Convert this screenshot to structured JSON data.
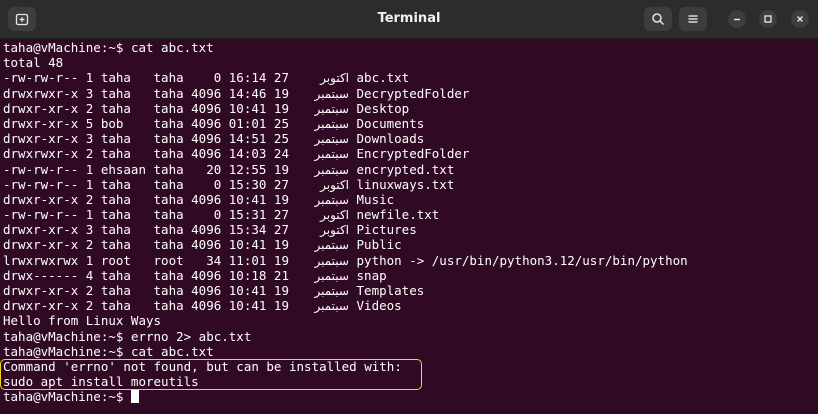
{
  "window": {
    "title": "Terminal"
  },
  "icons": {
    "new_tab": "new-tab-icon",
    "search": "search-icon",
    "menu": "hamburger-menu-icon",
    "minimize": "minimize-icon",
    "maximize": "maximize-icon",
    "close": "close-icon"
  },
  "colors": {
    "terminal_bg": "#300a24",
    "titlebar_bg": "#2c2c2c",
    "highlight_border": "#f6d51a",
    "text": "#ffffff"
  },
  "prompt": "taha@vMachine:~$",
  "lines": [
    {
      "type": "cmd",
      "command": "cat abc.txt"
    },
    {
      "type": "text",
      "text": "total 48"
    },
    {
      "type": "ls",
      "pre": "-rw-rw-r-- 1 taha   taha    0 16:14 27",
      "month": "اكتوبر",
      "name": "abc.txt"
    },
    {
      "type": "ls",
      "pre": "drwxrwxr-x 3 taha   taha 4096 14:46 19",
      "month": "سبتمبر",
      "name": "DecryptedFolder"
    },
    {
      "type": "ls",
      "pre": "drwxr-xr-x 2 taha   taha 4096 10:41 19",
      "month": "سبتمبر",
      "name": "Desktop"
    },
    {
      "type": "ls",
      "pre": "drwxr-xr-x 5 bob    taha 4096 01:01 25",
      "month": "سبتمبر",
      "name": "Documents"
    },
    {
      "type": "ls",
      "pre": "drwxr-xr-x 3 taha   taha 4096 14:51 25",
      "month": "سبتمبر",
      "name": "Downloads"
    },
    {
      "type": "ls",
      "pre": "drwxrwxr-x 2 taha   taha 4096 14:03 24",
      "month": "سبتمبر",
      "name": "EncryptedFolder"
    },
    {
      "type": "ls",
      "pre": "-rw-rw-r-- 1 ehsaan taha   20 12:55 19",
      "month": "سبتمبر",
      "name": "encrypted.txt"
    },
    {
      "type": "ls",
      "pre": "-rw-rw-r-- 1 taha   taha    0 15:30 27",
      "month": "اكتوبر",
      "name": "linuxways.txt"
    },
    {
      "type": "ls",
      "pre": "drwxr-xr-x 2 taha   taha 4096 10:41 19",
      "month": "سبتمبر",
      "name": "Music"
    },
    {
      "type": "ls",
      "pre": "-rw-rw-r-- 1 taha   taha    0 15:31 27",
      "month": "اكتوبر",
      "name": "newfile.txt"
    },
    {
      "type": "ls",
      "pre": "drwxr-xr-x 3 taha   taha 4096 15:34 27",
      "month": "اكتوبر",
      "name": "Pictures"
    },
    {
      "type": "ls",
      "pre": "drwxr-xr-x 2 taha   taha 4096 10:41 19",
      "month": "سبتمبر",
      "name": "Public"
    },
    {
      "type": "ls",
      "pre": "lrwxrwxrwx 1 root   root   34 11:01 19",
      "month": "سبتمبر",
      "name": "python -> /usr/bin/python3.12/usr/bin/python"
    },
    {
      "type": "ls",
      "pre": "drwx------ 4 taha   taha 4096 10:18 21",
      "month": "سبتمبر",
      "name": "snap"
    },
    {
      "type": "ls",
      "pre": "drwxr-xr-x 2 taha   taha 4096 10:41 19",
      "month": "سبتمبر",
      "name": "Templates"
    },
    {
      "type": "ls",
      "pre": "drwxr-xr-x 2 taha   taha 4096 10:41 19",
      "month": "سبتمبر",
      "name": "Videos"
    },
    {
      "type": "text",
      "text": "Hello from Linux Ways"
    },
    {
      "type": "cmd",
      "command": "errno 2> abc.txt"
    },
    {
      "type": "cmd",
      "command": "cat abc.txt"
    },
    {
      "type": "text",
      "text": "Command 'errno' not found, but can be installed with:"
    },
    {
      "type": "text",
      "text": "sudo apt install moreutils"
    },
    {
      "type": "cursor"
    }
  ]
}
